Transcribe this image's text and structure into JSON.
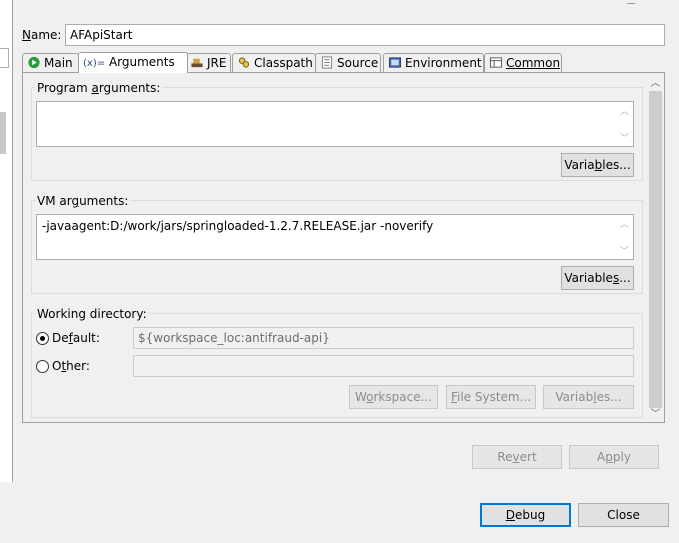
{
  "name": {
    "label": "Name:",
    "value": "AFApiStart"
  },
  "tabs": [
    {
      "label": "Main",
      "icon": "main-run-icon"
    },
    {
      "label": "Arguments",
      "icon": "arguments-icon",
      "icon_text": "(x)="
    },
    {
      "label": "JRE",
      "icon": "jre-icon"
    },
    {
      "label": "Classpath",
      "icon": "classpath-icon"
    },
    {
      "label": "Source",
      "icon": "source-icon"
    },
    {
      "label": "Environment",
      "icon": "environment-icon"
    },
    {
      "label": "Common",
      "icon": "common-icon"
    }
  ],
  "program_args": {
    "title": "Program arguments:",
    "value": "",
    "variables_label": "Variables..."
  },
  "vm_args": {
    "title": "VM arguments:",
    "value": "-javaagent:D:/work/jars/springloaded-1.2.7.RELEASE.jar  -noverify",
    "variables_label": "Variables..."
  },
  "working_dir": {
    "title": "Working directory:",
    "default_label": "Default:",
    "default_value": "${workspace_loc:antifraud-api}",
    "other_label": "Other:",
    "other_value": "",
    "workspace_label": "Workspace...",
    "filesystem_label": "File System...",
    "variables_label": "Variables..."
  },
  "actions": {
    "revert": "Revert",
    "apply": "Apply"
  },
  "footer": {
    "debug": "Debug",
    "close": "Close"
  }
}
